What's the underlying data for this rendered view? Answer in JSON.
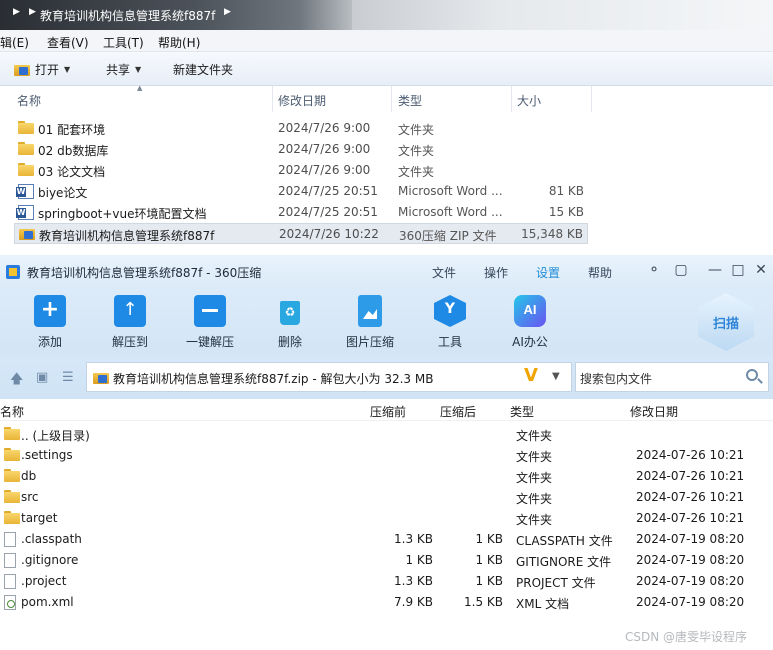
{
  "explorer": {
    "breadcrumb": "教育培训机构信息管理系统f887f",
    "menu": [
      "辑(E)",
      "查看(V)",
      "工具(T)",
      "帮助(H)"
    ],
    "toolbar": {
      "open": "打开",
      "share": "共享",
      "new_folder": "新建文件夹"
    },
    "columns": {
      "name": "名称",
      "modified": "修改日期",
      "type": "类型",
      "size": "大小"
    },
    "files": [
      {
        "icon": "folder-icon",
        "name": "01 配套环境",
        "modified": "2024/7/26 9:00",
        "type": "文件夹",
        "size": ""
      },
      {
        "icon": "folder-icon",
        "name": "02 db数据库",
        "modified": "2024/7/26 9:00",
        "type": "文件夹",
        "size": ""
      },
      {
        "icon": "folder-icon",
        "name": "03 论文文档",
        "modified": "2024/7/26 9:00",
        "type": "文件夹",
        "size": ""
      },
      {
        "icon": "word-icon",
        "name": "biye论文",
        "modified": "2024/7/25 20:51",
        "type": "Microsoft Word ...",
        "size": "81 KB"
      },
      {
        "icon": "word-icon",
        "name": "springboot+vue环境配置文档",
        "modified": "2024/7/25 20:51",
        "type": "Microsoft Word ...",
        "size": "15 KB"
      },
      {
        "icon": "zip-icon",
        "name": "教育培训机构信息管理系统f887f",
        "modified": "2024/7/26 10:22",
        "type": "360压缩 ZIP 文件",
        "size": "15,348 KB",
        "selected": true
      }
    ]
  },
  "zip": {
    "title": "教育培训机构信息管理系统f887f - 360压缩",
    "menus": [
      "文件",
      "操作",
      "设置",
      "帮助"
    ],
    "active_menu": "设置",
    "toolbar": [
      {
        "icon": "add-icon",
        "label": "添加"
      },
      {
        "icon": "extract-to-icon",
        "label": "解压到"
      },
      {
        "icon": "one-click-extract-icon",
        "label": "一键解压"
      },
      {
        "icon": "delete-icon",
        "label": "删除"
      },
      {
        "icon": "image-compress-icon",
        "label": "图片压缩"
      },
      {
        "icon": "tools-icon",
        "label": "工具"
      },
      {
        "icon": "ai-icon",
        "label": "AI办公"
      }
    ],
    "scan_label": "扫描",
    "path_text": "教育培训机构信息管理系统f887f.zip - 解包大小为 32.3 MB",
    "search_placeholder": "搜索包内文件",
    "columns": {
      "name": "名称",
      "original": "压缩前",
      "compressed": "压缩后",
      "type": "类型",
      "modified": "修改日期"
    },
    "files": [
      {
        "icon": "folder-icon",
        "name": ".. (上级目录)",
        "original": "",
        "compressed": "",
        "type": "文件夹",
        "modified": ""
      },
      {
        "icon": "folder-icon",
        "name": ".settings",
        "original": "",
        "compressed": "",
        "type": "文件夹",
        "modified": "2024-07-26 10:21"
      },
      {
        "icon": "folder-icon",
        "name": "db",
        "original": "",
        "compressed": "",
        "type": "文件夹",
        "modified": "2024-07-26 10:21"
      },
      {
        "icon": "folder-icon",
        "name": "src",
        "original": "",
        "compressed": "",
        "type": "文件夹",
        "modified": "2024-07-26 10:21"
      },
      {
        "icon": "folder-icon",
        "name": "target",
        "original": "",
        "compressed": "",
        "type": "文件夹",
        "modified": "2024-07-26 10:21"
      },
      {
        "icon": "file-icon",
        "name": ".classpath",
        "original": "1.3 KB",
        "compressed": "1 KB",
        "type": "CLASSPATH 文件",
        "modified": "2024-07-19 08:20"
      },
      {
        "icon": "file-icon",
        "name": ".gitignore",
        "original": "1 KB",
        "compressed": "1 KB",
        "type": "GITIGNORE 文件",
        "modified": "2024-07-19 08:20"
      },
      {
        "icon": "file-icon",
        "name": ".project",
        "original": "1.3 KB",
        "compressed": "1 KB",
        "type": "PROJECT 文件",
        "modified": "2024-07-19 08:20"
      },
      {
        "icon": "xml-icon",
        "name": "pom.xml",
        "original": "7.9 KB",
        "compressed": "1.5 KB",
        "type": "XML 文档",
        "modified": "2024-07-19 08:20"
      }
    ]
  },
  "watermark": "CSDN @唐雯毕设程序",
  "colors": {
    "accent": "#1f8bd8",
    "title_bg": "#dbeaf8",
    "selection": "#e5e9f0"
  }
}
